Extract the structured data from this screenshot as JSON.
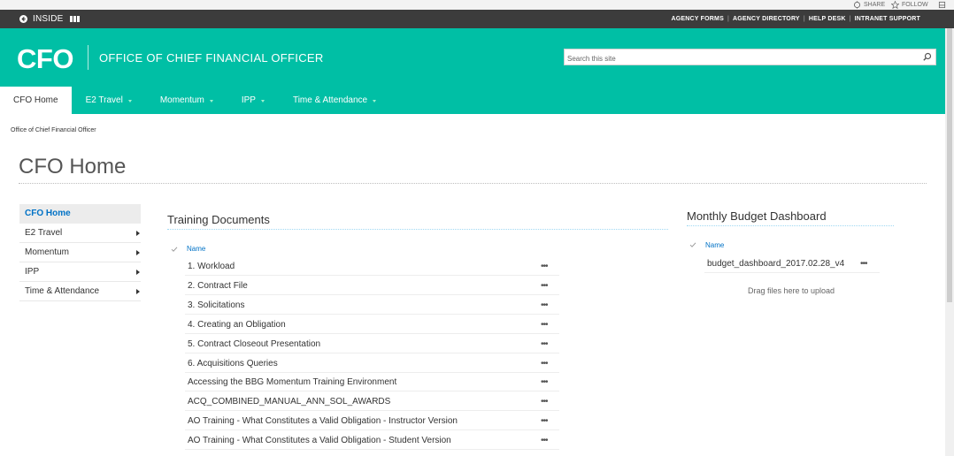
{
  "util": {
    "share_label": "SHARE",
    "follow_label": "FOLLOW"
  },
  "darkbar": {
    "back_label": "INSIDE",
    "links": [
      "AGENCY FORMS",
      "AGENCY DIRECTORY",
      "HELP DESK",
      "INTRANET SUPPORT"
    ]
  },
  "header": {
    "logo": "CFO",
    "site_title": "OFFICE OF CHIEF FINANCIAL OFFICER",
    "search_placeholder": "Search this site",
    "accent_color": "#00bfa5"
  },
  "nav": {
    "items": [
      {
        "label": "CFO Home"
      },
      {
        "label": "E2 Travel"
      },
      {
        "label": "Momentum"
      },
      {
        "label": "IPP"
      },
      {
        "label": "Time & Attendance"
      }
    ]
  },
  "breadcrumb": "Office of Chief Financial Officer",
  "page_title": "CFO Home",
  "leftnav": {
    "items": [
      {
        "label": "CFO Home"
      },
      {
        "label": "E2 Travel"
      },
      {
        "label": "Momentum"
      },
      {
        "label": "IPP"
      },
      {
        "label": "Time & Attendance"
      }
    ]
  },
  "training": {
    "title": "Training Documents",
    "column_name": "Name",
    "rows": [
      "1. Workload",
      "2. Contract File",
      "3. Solicitations",
      "4. Creating an Obligation",
      "5. Contract Closeout Presentation",
      "6. Acquisitions Queries",
      "Accessing the BBG Momentum Training Environment",
      "ACQ_COMBINED_MANUAL_ANN_SOL_AWARDS",
      "AO Training - What Constitutes a Valid Obligation - Instructor Version",
      "AO Training - What Constitutes a Valid Obligation - Student Version"
    ],
    "row_menu": "•••"
  },
  "budget": {
    "title": "Monthly Budget Dashboard",
    "column_name": "Name",
    "file": "budget_dashboard_2017.02.28_v4",
    "row_menu": "•••",
    "drag_text": "Drag files here to upload"
  }
}
